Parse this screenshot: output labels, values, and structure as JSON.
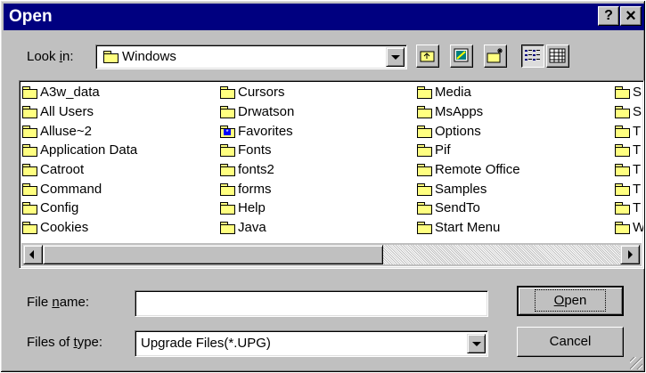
{
  "window": {
    "title": "Open",
    "help_button": "?",
    "close_button": "×"
  },
  "look_in": {
    "label_pre": "Look ",
    "label_u": "i",
    "label_post": "n:",
    "value": "Windows"
  },
  "toolbar": {
    "up_folder": "up-folder-icon",
    "desktop": "desktop-icon",
    "new_folder": "new-folder-icon",
    "list_view": "list-view-icon",
    "details_view": "details-view-icon"
  },
  "files": {
    "columns": [
      [
        "A3w_data",
        "All Users",
        "Alluse~2",
        "Application Data",
        "Catroot",
        "Command",
        "Config",
        "Cookies"
      ],
      [
        "Cursors",
        "Drwatson",
        "Favorites",
        "Fonts",
        "fonts2",
        "forms",
        "Help",
        "Java"
      ],
      [
        "Media",
        "MsApps",
        "Options",
        "Pif",
        "Remote Office",
        "Samples",
        "SendTo",
        "Start Menu"
      ],
      [
        "S",
        "S",
        "T",
        "T",
        "T",
        "T",
        "T",
        "W"
      ]
    ]
  },
  "file_name": {
    "label_pre": "File ",
    "label_u": "n",
    "label_post": "ame:",
    "value": ""
  },
  "file_type": {
    "label_pre": "Files of ",
    "label_u": "t",
    "label_post": "ype:",
    "value": "Upgrade Files(*.UPG)"
  },
  "buttons": {
    "open_u": "O",
    "open_rest": "pen",
    "cancel": "Cancel"
  },
  "colors": {
    "titlebar": "#000080",
    "face": "#c0c0c0",
    "folder": "#ffff80"
  }
}
